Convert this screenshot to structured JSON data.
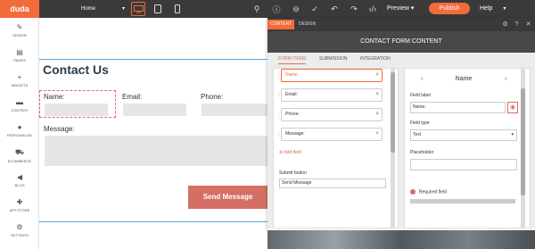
{
  "topbar": {
    "logo": "duda",
    "page_select": "Home",
    "preview": "Preview",
    "publish": "Publish",
    "help": "Help",
    "icons": [
      "desktop-icon",
      "tablet-icon",
      "mobile-icon",
      "search-icon",
      "info-icon",
      "zoom-out-icon",
      "check-icon",
      "undo-icon",
      "redo-icon",
      "code-icon"
    ]
  },
  "sidebar": {
    "items": [
      {
        "label": "DESIGN",
        "icon": "brush-icon"
      },
      {
        "label": "PAGES",
        "icon": "pages-icon"
      },
      {
        "label": "WIDGETS",
        "icon": "plus-icon"
      },
      {
        "label": "CONTENT",
        "icon": "folder-icon"
      },
      {
        "label": "PERSONALIZE",
        "icon": "person-icon"
      },
      {
        "label": "ECOMMERCE",
        "icon": "cart-icon"
      },
      {
        "label": "BLOG",
        "icon": "megaphone-icon"
      },
      {
        "label": "APP STORE",
        "icon": "puzzle-icon"
      },
      {
        "label": "SETTINGS",
        "icon": "gear-icon"
      }
    ]
  },
  "canvas": {
    "title": "Contact Us",
    "name_label": "Name:",
    "email_label": "Email:",
    "phone_label": "Phone:",
    "message_label": "Message:",
    "send_button": "Send Message"
  },
  "panel": {
    "tab_content": "CONTENT",
    "tab_design": "DESIGN",
    "title": "CONTACT FORM CONTENT",
    "subtabs": [
      "FORM ITEMS",
      "SUBMISSION",
      "INTEGRATION"
    ],
    "form_items": [
      "Name:",
      "Email:",
      "Phone:",
      "Message:"
    ],
    "add_field": "Add field",
    "submit_label": "Submit button",
    "submit_value": "Send Message",
    "editor": {
      "heading": "Name",
      "field_label_title": "Field label",
      "field_label_value": "Name:",
      "field_type_title": "Field type",
      "field_type_value": "Text",
      "placeholder_title": "Placeholder",
      "placeholder_value": "",
      "required_label": "Required field"
    }
  },
  "colors": {
    "accent": "#f26b3a",
    "send_button": "#d46f66",
    "topbar": "#3a3a3a"
  }
}
